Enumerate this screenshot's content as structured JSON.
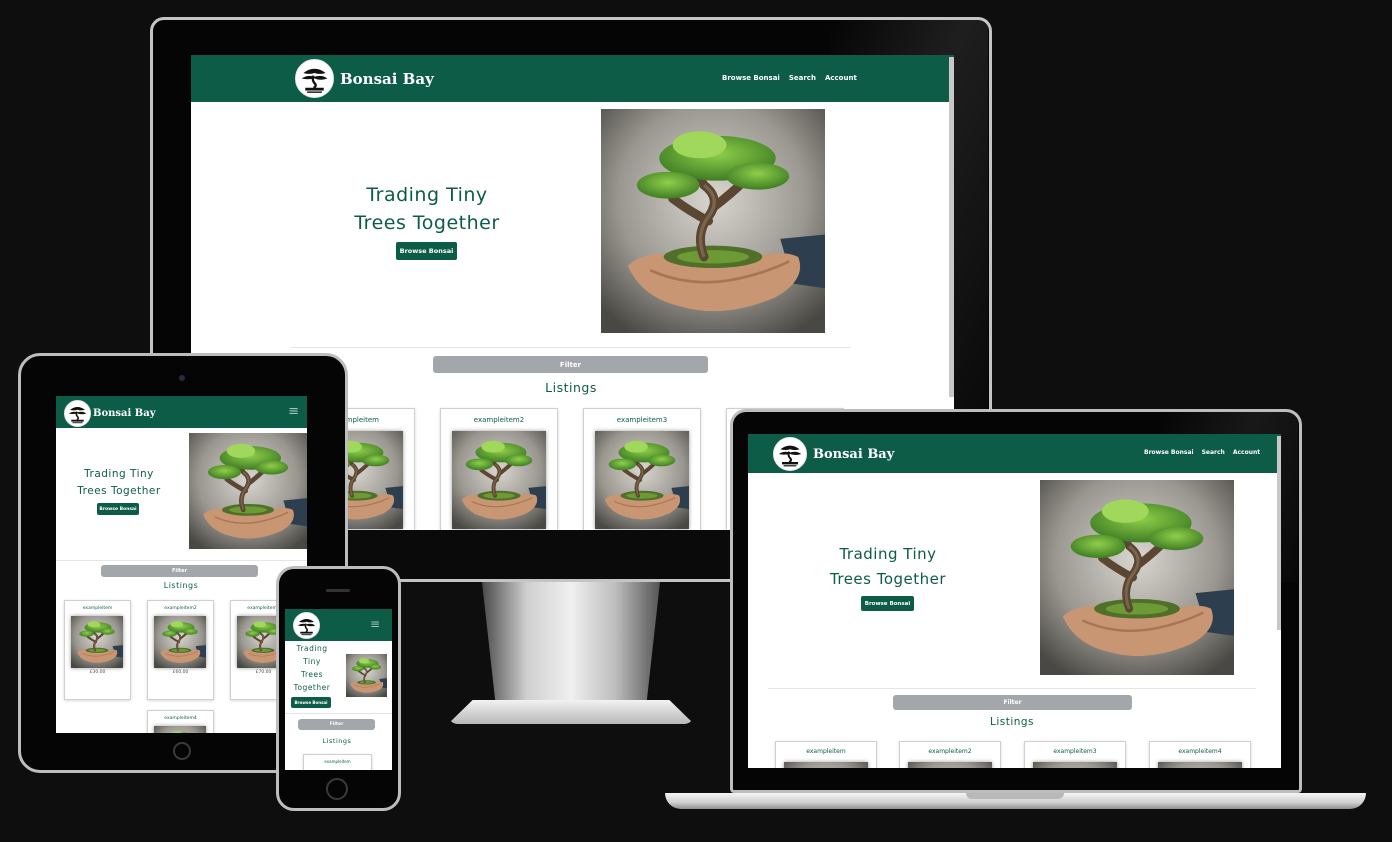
{
  "site": {
    "brand": "Bonsai Bay",
    "nav": [
      "Browse Bonsai",
      "Search",
      "Account"
    ],
    "hero_line1": "Trading Tiny",
    "hero_line2": "Trees Together",
    "hero_lines_mobile": [
      "Trading",
      "Tiny",
      "Trees",
      "Together"
    ],
    "cta": "Browse Bonsai",
    "filter": "Filter",
    "listings": "Listings",
    "items": [
      "exampleitem",
      "exampleitem2",
      "exampleitem3",
      "exampleitem4"
    ],
    "prices": [
      "£30.00",
      "£60.00",
      "£70.00"
    ],
    "hamburger": "≡"
  },
  "colors": {
    "primary": "#0d5c48",
    "filter": "#a3a7ab",
    "background": "#0e0e0e"
  },
  "icons": {
    "logo": "bonsai-logo-icon",
    "menu": "hamburger-menu-icon"
  }
}
